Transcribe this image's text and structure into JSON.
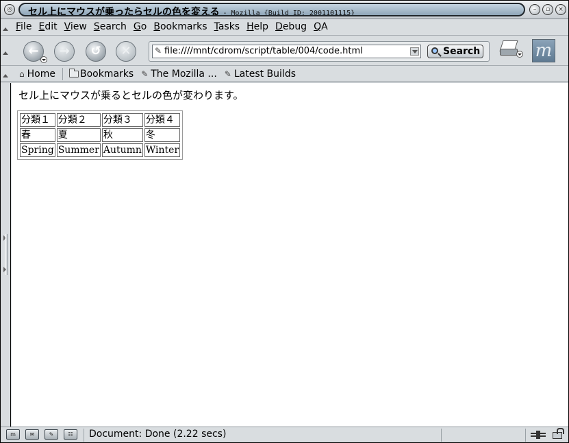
{
  "window": {
    "title": "セル上にマウスが乗ったらセルの色を変える",
    "subtitle": "- Mozilla {Build ID: 2001101115}"
  },
  "menu": [
    {
      "mnemonic": "F",
      "rest": "ile"
    },
    {
      "mnemonic": "E",
      "rest": "dit"
    },
    {
      "mnemonic": "V",
      "rest": "iew"
    },
    {
      "mnemonic": "S",
      "rest": "earch"
    },
    {
      "mnemonic": "G",
      "rest": "o"
    },
    {
      "mnemonic": "B",
      "rest": "ookmarks"
    },
    {
      "mnemonic": "T",
      "rest": "asks"
    },
    {
      "mnemonic": "H",
      "rest": "elp"
    },
    {
      "mnemonic": "D",
      "rest": "ebug"
    },
    {
      "mnemonic": "Q",
      "rest": "A"
    }
  ],
  "nav": {
    "url": "file:////mnt/cdrom/script/table/004/code.html",
    "search_label": "Search",
    "back_icon": "back-arrow-icon",
    "forward_icon": "forward-arrow-icon",
    "reload_icon": "reload-icon",
    "stop_icon": "stop-icon"
  },
  "personal": [
    {
      "label": "Home",
      "icon": "home-icon"
    },
    {
      "label": "Bookmarks",
      "icon": "folder-icon"
    },
    {
      "label": "The Mozilla ...",
      "icon": "bookmark-icon"
    },
    {
      "label": "Latest Builds",
      "icon": "bookmark-icon"
    }
  ],
  "page": {
    "sentence": "セル上にマウスが乗るとセルの色が変わります。",
    "table": {
      "rows": [
        [
          "分類１",
          "分類２",
          "分類３",
          "分類４"
        ],
        [
          "春",
          "夏",
          "秋",
          "冬"
        ],
        [
          "Spring",
          "Summer",
          "Autumn",
          "Winter"
        ]
      ]
    }
  },
  "status": {
    "text": "Document: Done (2.22 secs)"
  },
  "colors": {
    "chrome": "#d9dde0",
    "title_pill": "#8fa6b8",
    "content_bg": "#ffffff",
    "cell_border": "#6a6a6a"
  }
}
